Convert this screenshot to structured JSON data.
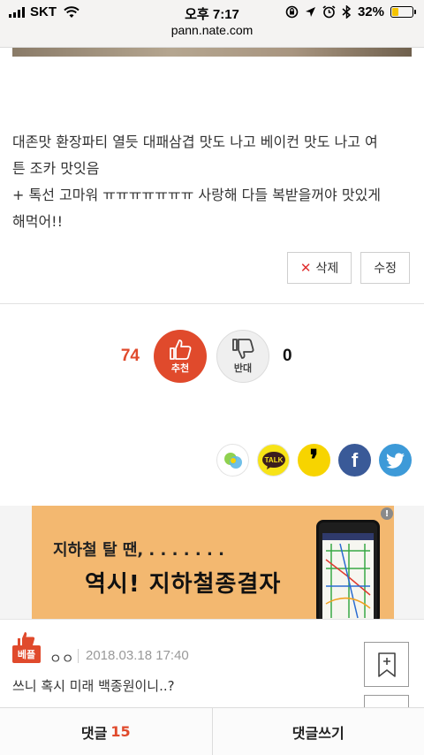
{
  "status_bar": {
    "carrier": "SKT",
    "time": "오후 7:17",
    "battery_percent": "32%",
    "battery_level": 0.32,
    "url": "pann.nate.com"
  },
  "post": {
    "body_lines": [
      "대존맛 환장파티 열듯 대패삼겹 맛도 나고 베이컨 맛도 나고 여",
      "튼 조카 맛잇음",
      "+ 톡선 고마워 ㅠㅠㅠㅠㅠㅠㅠ 사랑해 다들 복받을꺼야 맛있게",
      "해먹어!!"
    ],
    "delete_label": "삭제",
    "edit_label": "수정"
  },
  "vote": {
    "up_count": "74",
    "up_label": "추천",
    "down_label": "반대",
    "down_count": "0"
  },
  "share": {
    "items": [
      "kakaostory-icon",
      "kakaotalk-icon",
      "comma-icon",
      "facebook-icon",
      "twitter-icon"
    ],
    "talk_label": "TALK",
    "fb_label": "f",
    "comma_label": "❜"
  },
  "ad": {
    "line1": "지하철 탈 땐, . . . . . . .",
    "line2": "역시! 지하철종결자",
    "badge": "!"
  },
  "comment": {
    "badge": "베플",
    "author": "ㅇㅇ",
    "date": "2018.03.18 17:40",
    "text": "쓰니 혹시 미래 백종원이니..?"
  },
  "bottom_bar": {
    "comments_label": "댓글",
    "comments_count": "15",
    "write_label": "댓글쓰기"
  },
  "colors": {
    "accent": "#e04a2c",
    "ad_bg": "#f3b870",
    "facebook": "#3a5a98",
    "twitter": "#3d9ad8",
    "kakao": "#f7e317"
  }
}
